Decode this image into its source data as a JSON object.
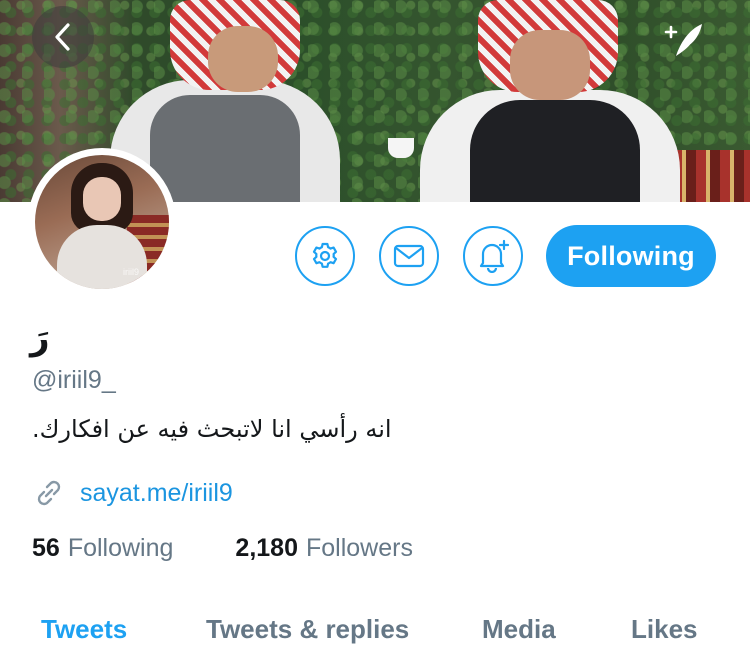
{
  "header": {
    "back_icon": "chevron-left-icon",
    "compose_icon": "compose-tweet-icon"
  },
  "profile": {
    "display_name": "رَ",
    "handle": "@iriil9_",
    "bio": "انه رأسي انا لاتبحث فيه عن افكارك.",
    "link": "sayat.me/iriil9",
    "avatar_watermark": "iriil9",
    "following_count": "56",
    "following_label": "Following",
    "followers_count": "2,180",
    "followers_label": "Followers"
  },
  "actions": {
    "settings_icon": "gear-icon",
    "message_icon": "envelope-icon",
    "notify_icon": "bell-plus-icon",
    "follow_button": "Following"
  },
  "tabs": [
    {
      "label": "Tweets",
      "active": true
    },
    {
      "label": "Tweets & replies",
      "active": false
    },
    {
      "label": "Media",
      "active": false
    },
    {
      "label": "Likes",
      "active": false
    }
  ],
  "colors": {
    "accent": "#1da1f2",
    "link": "#1b95e0",
    "muted": "#657786",
    "text": "#14171a"
  }
}
